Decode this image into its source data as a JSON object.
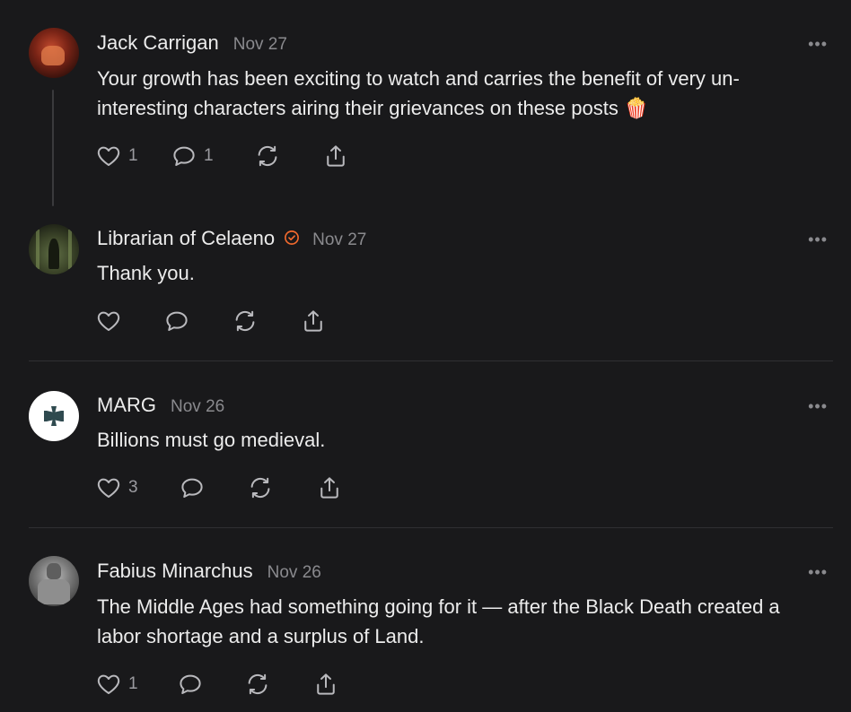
{
  "comments": [
    {
      "author": "Jack Carrigan",
      "date": "Nov 27",
      "verified": false,
      "text": "Your growth has been exciting to watch and carries the benefit of very un-interesting characters airing their grievances on these posts 🍿",
      "like_count": "1",
      "reply_count": "1"
    },
    {
      "author": "Librarian of Celaeno",
      "date": "Nov 27",
      "verified": true,
      "text": "Thank you.",
      "like_count": "",
      "reply_count": ""
    },
    {
      "author": "MARG",
      "date": "Nov 26",
      "verified": false,
      "text": "Billions must go medieval.",
      "like_count": "3",
      "reply_count": ""
    },
    {
      "author": "Fabius Minarchus",
      "date": "Nov 26",
      "verified": false,
      "text": "The Middle Ages had something going for it — after the Black Death created a labor shortage and a surplus of Land.",
      "like_count": "1",
      "reply_count": ""
    }
  ],
  "more_label": "•••",
  "colors": {
    "background": "#19191b",
    "verified": "#f26a2e",
    "muted": "#8a8a8e"
  },
  "icons": [
    "heart-icon",
    "comment-icon",
    "restack-icon",
    "share-icon",
    "more-icon",
    "verified-badge-icon"
  ]
}
